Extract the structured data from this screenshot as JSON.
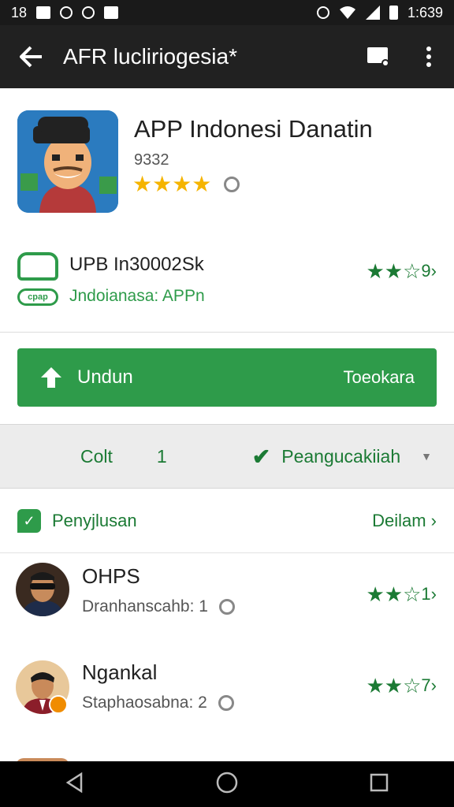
{
  "status": {
    "left": "18",
    "time": "1:639"
  },
  "toolbar": {
    "title": "AFR lucliriogesia*",
    "back_icon": "back-arrow-icon",
    "screen_icon": "cast-icon",
    "menu_icon": "more-vertical-icon"
  },
  "app": {
    "title": "APP Indonesi  Danatin",
    "count": "9332",
    "stars": "★★★★"
  },
  "developer": {
    "logo_tag": "cpap",
    "name": "UPB In30002Sk",
    "subtitle": "Jndoianasa: APPn",
    "stars": "★★☆",
    "count": "9",
    "chevron": "›"
  },
  "install": {
    "label": "Undun",
    "right_label": "Toeokara"
  },
  "filter": {
    "left_label": "Colt",
    "left_count": "1",
    "right_label": "Peangucakiiah",
    "caret": "▼"
  },
  "reviews": {
    "header_label": "Penyjlusan",
    "more_label": "Deilam ›",
    "items": [
      {
        "name": "OHPS",
        "subtitle": "Dranhanscahb: 1",
        "stars": "★★☆",
        "count": "1",
        "chevron": "›"
      },
      {
        "name": "Ngankal",
        "subtitle": "Staphaosabna: 2",
        "stars": "★★☆",
        "count": "7",
        "chevron": "›"
      }
    ]
  },
  "colors": {
    "accent": "#2e9b4a",
    "toolbar": "#212121",
    "star_gold": "#f5b400",
    "star_green": "#1b7a34"
  }
}
